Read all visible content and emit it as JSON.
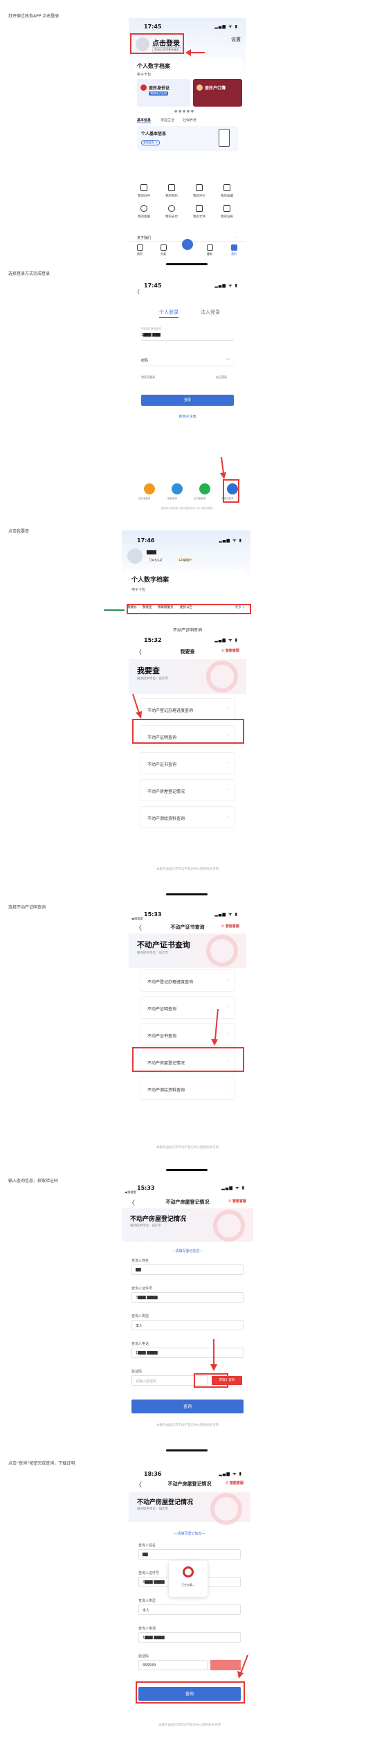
{
  "steps": {
    "s1": "打开宿迁政务APP 点击登录",
    "s2": "选择登录方式完成登录",
    "s3": "点击我要查",
    "s4": "选择不动产证明查询",
    "s5": "选择不动产房屋登记情况",
    "s6": "输入查询信息，获取验证码",
    "s7": "点击“查询”按钮完成查询，下载证明"
  },
  "screen1": {
    "time": "17:45",
    "status_icons": "▂▄▆ ᯤ ▮",
    "login_title": "点击登录",
    "login_sub": "登录后享受更多服务",
    "settings": "设置",
    "archive_title": "个人数字档案",
    "card_pack": "电子卡包",
    "card1_title": "居民身份证",
    "card1_sub": "领取电子证照",
    "card2_title": "居民户口簿",
    "tab_basic": "基本信息",
    "tab_family": "家庭生活",
    "tab_social": "社保养老",
    "basic_info": "个人基本信息",
    "view_more": "查看更多 >",
    "grid": [
      "我的办件",
      "我的预约",
      "我的评价",
      "我的收藏",
      "我的收藏",
      "我的支付",
      "我的文件",
      "我的证照"
    ],
    "about": "关于我们",
    "nav": [
      "首页",
      "分类",
      "",
      "服务",
      "我的"
    ]
  },
  "screen2": {
    "time": "17:45",
    "status_icons": "▂▄▆ ᯤ ▮",
    "back": "〈",
    "tab_personal": "个人登录",
    "tab_legal": "法人登录",
    "id_label": "手机号/身份证号",
    "id_value": "1▇▇▇  ▇▇▇",
    "password_label": "密码",
    "forgot": "忘记密码",
    "sms_login": "验证码登录",
    "login_button": "登录",
    "register": "新用户注册",
    "other_login": [
      "支付宝登录",
      "微信登录",
      "支付宝登录",
      "苏服办登录"
    ],
    "agreement": "登录即代表同意《用户服务协议》和《隐私政策》"
  },
  "screen3": {
    "time": "17:46",
    "status_icons": "▂▄▆ ᯤ ▮",
    "user_name": "▇▇▇",
    "verified": "已实名认证",
    "level": "L3 级用户",
    "archive_title": "个人数字档案",
    "card_pack": "电子卡包",
    "nav_items": [
      "我要办",
      "我要查",
      "物联网服务",
      "便民公告"
    ],
    "more": "更多 >"
  },
  "screen4": {
    "top_label": "不动产证明查询",
    "time": "15:32",
    "status_icons": "▂▄▆ ᯤ ▮",
    "back": "〈",
    "nav_title": "我要查",
    "svc": "✆ 智能客服",
    "hero_title": "我要查",
    "hero_sub": "服务提供单位：宿迁市",
    "rows": [
      "不动产登记办理进度查询",
      "不动产证明查询",
      "不动产证书查询",
      "不动产房屋登记情况",
      "不动产测绘资料查询"
    ],
    "footer": "本服务由宿迁市不动产登记中心提供技术支持"
  },
  "screen5": {
    "time": "15:33",
    "carrier": "◀ 照相馆",
    "status_icons": "▂▄▆ ᯤ ▮",
    "back": "〈",
    "nav_title": "不动产证书查询",
    "svc": "✆ 智能客服",
    "hero_title": "不动产证书查询",
    "hero_sub": "服务提供单位：宿迁市",
    "rows": [
      "不动产登记办理进度查询",
      "不动产证明查询",
      "不动产证书查询",
      "不动产房屋登记情况",
      "不动产测绘资料查询"
    ],
    "footer": "本服务由宿迁市不动产登记中心提供技术支持"
  },
  "screen6": {
    "time": "15:33",
    "carrier": "◀ 照相馆",
    "status_icons": "▂▄▆ ᯤ ▮",
    "back": "〈",
    "nav_title": "不动产房屋登记情况",
    "svc": "✆ 智能客服",
    "hero_title": "不动产房屋登记情况",
    "hero_sub": "服务提供单位：宿迁市",
    "section": "—请填写登记信息—",
    "name_label": "查询人姓名",
    "name_value": "▇▇",
    "id_label": "查询人证件号",
    "id_value": "3▇▇▇  ▇▇▇▇",
    "type_label": "查询人类型",
    "type_value": "本人",
    "phone_label": "查询人电话",
    "phone_value": "1▇▇▇  ▇▇▇▇",
    "code_label": "验证码",
    "code_placeholder": "请输入验证码",
    "get_code": "获取验证码",
    "query_button": "查询",
    "footer": "本服务由宿迁市不动产登记中心提供技术支持"
  },
  "screen7": {
    "time": "18:36",
    "status_icons": "▂▄▆ ᯤ ▮",
    "back": "〈",
    "nav_title": "不动产房屋登记情况",
    "svc": "✆ 智能客服",
    "hero_title": "不动产房屋登记情况",
    "hero_sub": "服务提供单位：宿迁市",
    "section": "—请填写登记信息—",
    "name_label": "查询人姓名",
    "name_value": "▇▇",
    "id_label": "查询人证件号",
    "id_value": "3▇▇▇  ▇▇▇▇",
    "type_label": "查询人类型",
    "type_value": "本人",
    "phone_label": "查询人电话",
    "phone_value": "1▇▇▇  ▇▇▇▇",
    "code_label": "验证码",
    "code_value": "455589",
    "toast": "正在加载...",
    "query_button": "查询",
    "footer": "本服务由宿迁市不动产登记中心提供技术支持"
  },
  "colors": {
    "accent": "#3b6fd4",
    "annotation": "#e53935",
    "brand_red": "#d32f2f"
  }
}
